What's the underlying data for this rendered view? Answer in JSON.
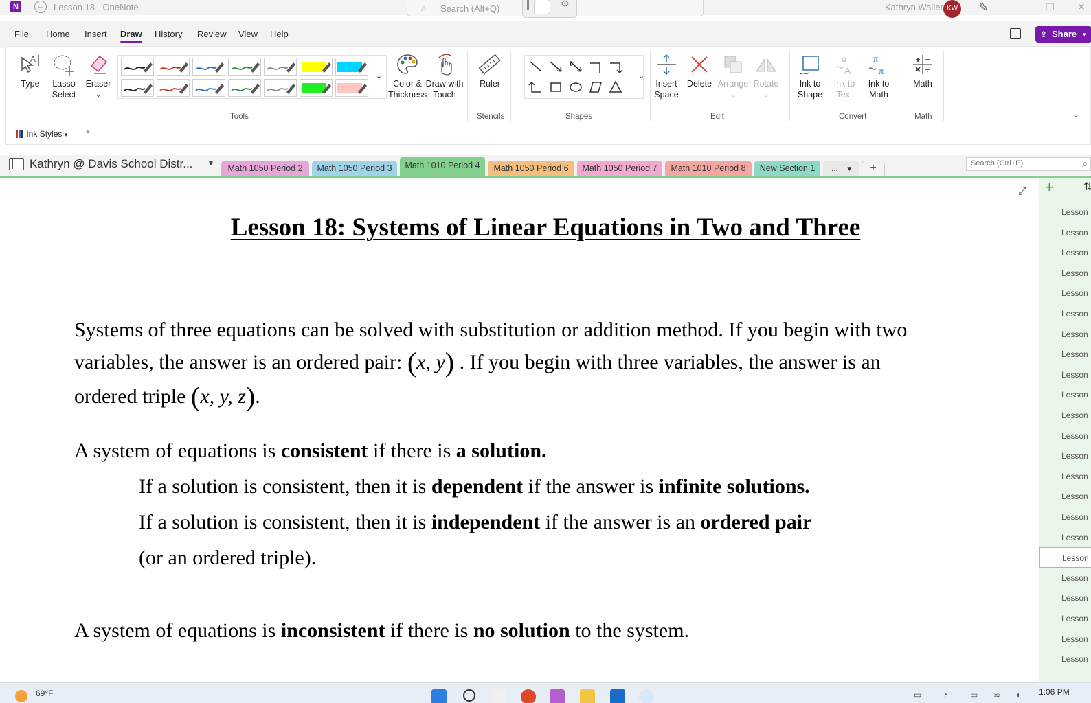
{
  "window": {
    "app_icon": "N",
    "title": "Lesson 18  -  OneNote",
    "search_placeholder": "Search (Alt+Q)",
    "user_name": "Kathryn Waller",
    "user_initials": "KW"
  },
  "menu": {
    "file": "File",
    "home": "Home",
    "insert": "Insert",
    "draw": "Draw",
    "history": "History",
    "review": "Review",
    "view": "View",
    "help": "Help",
    "share": "Share"
  },
  "ribbon": {
    "type": "Type",
    "lasso_select": "Lasso Select",
    "eraser": "Eraser",
    "color_thickness": "Color & Thickness",
    "draw_with_touch": "Draw with Touch",
    "ruler": "Ruler",
    "insert_space": "Insert Space",
    "delete": "Delete",
    "arrange": "Arrange",
    "rotate": "Rotate",
    "ink_to_shape": "Ink to Shape",
    "ink_to_text": "Ink to Text",
    "ink_to_math": "Ink to Math",
    "math": "Math",
    "groups": {
      "tools": "Tools",
      "stencils": "Stencils",
      "shapes": "Shapes",
      "edit": "Edit",
      "convert": "Convert",
      "math": "Math"
    },
    "pen_colors": {
      "row1": [
        "#1a1a1a",
        "#c0392b",
        "#2e6fba",
        "#2e8b3a",
        "#8a8a8a",
        "#ffff00",
        "#00d5ff"
      ],
      "row2": [
        "#1a1a1a",
        "#c0392b",
        "#2e6fba",
        "#2e8b3a",
        "#8a8a8a",
        "#22ee22",
        "#ffc4c4"
      ]
    },
    "ink_styles": "Ink Styles"
  },
  "notebook": {
    "name": "Kathryn @ Davis School Distr...",
    "sections": [
      {
        "label": "Math 1050 Period 2",
        "color": "#e6a6d8"
      },
      {
        "label": "Math 1050 Period 3",
        "color": "#9fd3e8"
      },
      {
        "label": "Math 1010 Period 4",
        "color": "#84d18f"
      },
      {
        "label": "Math 1050 Period 6",
        "color": "#f5bd7e"
      },
      {
        "label": "Math 1050 Period 7",
        "color": "#f2a8cf"
      },
      {
        "label": "Math 1010 Period 8",
        "color": "#f4a6a0"
      },
      {
        "label": "New Section 1",
        "color": "#8fd8c6"
      }
    ],
    "more": "...",
    "add": "+",
    "search_placeholder": "Search (Ctrl+E)"
  },
  "page": {
    "title": "Lesson 18: Systems of Linear Equations in Two and Three",
    "p1_line1": "Systems of three equations can be solved with substitution or addition method.  If you begin with two",
    "p1_line2a": "variables, the answer is an ordered pair:",
    "p1_pair": "x, y",
    "p1_line2b": ".  If you begin with three variables, the answer is an",
    "p1_line3a": "ordered triple",
    "p1_triple": "x, y, z",
    "p1_line3b": ".",
    "consistent": {
      "pre": "A system of equations is ",
      "bold1": "consistent",
      "mid": " if there is ",
      "bold2": "a solution."
    },
    "dependent": {
      "pre": "If a solution is consistent, then it is ",
      "bold1": "dependent",
      "mid": " if the answer is ",
      "bold2": "infinite solutions."
    },
    "independent": {
      "pre": "If a solution is consistent, then it is ",
      "bold1": "independent",
      "mid": " if the answer is an ",
      "bold2": "ordered pair"
    },
    "independent_cont": "(or an ordered triple).",
    "inconsistent": {
      "pre": "A system of equations is ",
      "bold1": "inconsistent",
      "mid": " if there is ",
      "bold2": "no solution",
      "post": " to the system."
    }
  },
  "pages_list": {
    "items": [
      "Lesson",
      "Lesson",
      "Lesson",
      "Lesson",
      "Lesson",
      "Lesson",
      "Lesson",
      "Lesson",
      "Lesson",
      "Lesson",
      "Lesson",
      "Lesson",
      "Lesson",
      "Lesson",
      "Lesson",
      "Lesson",
      "Lesson",
      "Lesson",
      "Lesson",
      "Lesson",
      "Lesson",
      "Lesson",
      "Lesson"
    ],
    "active_index": 17
  },
  "taskbar": {
    "temperature": "69°F",
    "time": "1:06 PM"
  }
}
